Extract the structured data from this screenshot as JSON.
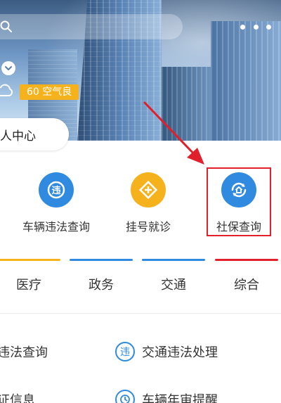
{
  "hero": {
    "air_quality": "60 空气良"
  },
  "personal_center": {
    "label": "人中心"
  },
  "services": [
    {
      "label": "车辆违法查询",
      "icon": "violation-badge-icon",
      "color": "#2f8ae0"
    },
    {
      "label": "挂号就诊",
      "icon": "medical-cross-icon",
      "color": "#f5b21c"
    },
    {
      "label": "社保查询",
      "icon": "social-security-icon",
      "color": "#2f8ae0"
    }
  ],
  "tabs": [
    {
      "label": "医疗",
      "color": "#f5b21c"
    },
    {
      "label": "政务",
      "color": "#2f8ae0"
    },
    {
      "label": "交通",
      "color": "#2f8ae0"
    },
    {
      "label": "综合",
      "color": "#e0202a"
    }
  ],
  "list": [
    {
      "label": "违法查询"
    },
    {
      "label": "交通违法处理",
      "icon": "violation-badge-icon"
    },
    {
      "label": "证信息"
    },
    {
      "label": "车辆年审提醒",
      "icon": "clock-icon"
    }
  ],
  "annotation": {
    "highlight_color": "#e0202a"
  }
}
